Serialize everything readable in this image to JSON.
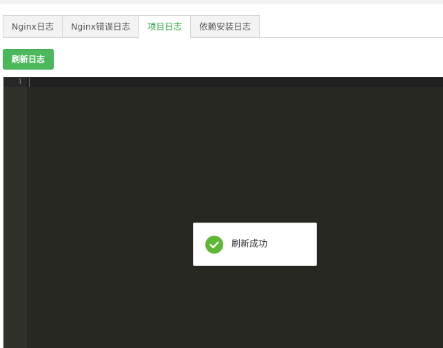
{
  "tabs": [
    {
      "label": "Nginx日志",
      "active": false
    },
    {
      "label": "Nginx错误日志",
      "active": false
    },
    {
      "label": "项目日志",
      "active": true
    },
    {
      "label": "依赖安装日志",
      "active": false
    }
  ],
  "toolbar": {
    "refresh_label": "刷新日志"
  },
  "editor": {
    "line_numbers": [
      "1"
    ],
    "content": ""
  },
  "toast": {
    "message": "刷新成功",
    "icon": "check-circle-icon"
  },
  "colors": {
    "accent": "#20a53a",
    "button_bg": "#4cb85c",
    "editor_bg": "#272822",
    "gutter_bg": "#2f3129",
    "toast_icon": "#5fb832"
  }
}
